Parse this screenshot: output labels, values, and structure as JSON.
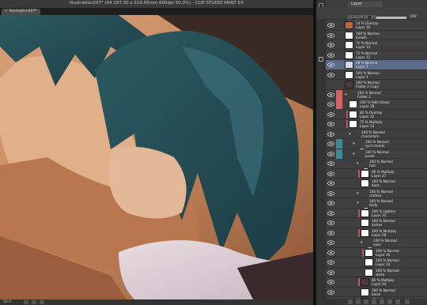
{
  "app_title": "Illustration207* (A4 297.00 x 210.00mm 600dpi 50.0%) - CLIP STUDIO PAINT EX",
  "document_tab": "Illustration207*",
  "canvas": {
    "zoom": "50.0"
  },
  "layer_panel": {
    "tab_label": "Layer",
    "blend_mode": "Normal",
    "opacity_value": "100",
    "layers": [
      {
        "line1": "14 % Overlay",
        "line2": "Layer 16",
        "kind": "layer",
        "thumb": "#b86a3a",
        "indent": 0,
        "visible": true,
        "selected": false,
        "clip": false,
        "chip": ""
      },
      {
        "line1": "100 % Normal",
        "line2": "breath",
        "kind": "layer",
        "thumb": "#ffffff",
        "indent": 0,
        "visible": true,
        "selected": false,
        "clip": false,
        "chip": ""
      },
      {
        "line1": "72 % Normal",
        "line2": "Layer 12",
        "kind": "layer",
        "thumb": "#ffffff",
        "indent": 0,
        "visible": true,
        "selected": false,
        "clip": false,
        "chip": ""
      },
      {
        "line1": "72 % Normal",
        "line2": "Layer 11",
        "kind": "layer",
        "thumb": "#ffffff",
        "indent": 0,
        "visible": true,
        "selected": false,
        "clip": false,
        "chip": ""
      },
      {
        "line1": "48 % Normal",
        "line2": "Layer 7",
        "kind": "layer",
        "thumb": "#d8d8e8",
        "indent": 0,
        "visible": true,
        "selected": true,
        "clip": false,
        "chip": ""
      },
      {
        "line1": "100 % Normal",
        "line2": "Layer 1",
        "kind": "layer",
        "thumb": "#ffffff",
        "indent": 0,
        "visible": true,
        "selected": false,
        "clip": false,
        "chip": ""
      },
      {
        "line1": "100 % Normal",
        "line2": "Folder 2 Copy",
        "kind": "layer",
        "thumb": "#4a3a3a",
        "indent": 0,
        "visible": false,
        "selected": false,
        "clip": false,
        "chip": ""
      },
      {
        "line1": "100 % Normal",
        "line2": "Folder 2",
        "kind": "folder",
        "thumb": "",
        "indent": 0,
        "visible": true,
        "selected": false,
        "clip": false,
        "chip": "#d86060"
      },
      {
        "line1": "100 % Add (Glow)",
        "line2": "Layer 39",
        "kind": "layer",
        "thumb": "#ffffff",
        "indent": 1,
        "visible": true,
        "selected": false,
        "clip": false,
        "chip": "#d86060"
      },
      {
        "line1": "82 % Overlay",
        "line2": "Layer 32",
        "kind": "layer",
        "thumb": "#ffffff",
        "indent": 1,
        "visible": true,
        "selected": false,
        "clip": true,
        "chip": ""
      },
      {
        "line1": "75 % Multiply",
        "line2": "Layer 23",
        "kind": "layer",
        "thumb": "#ffffff",
        "indent": 1,
        "visible": true,
        "selected": false,
        "clip": true,
        "chip": ""
      },
      {
        "line1": "100 % Normal",
        "line2": "characters",
        "kind": "folder",
        "thumb": "",
        "indent": 1,
        "visible": true,
        "selected": false,
        "clip": false,
        "chip": ""
      },
      {
        "line1": "100 % Normal",
        "line2": "ryo's hands",
        "kind": "folder",
        "thumb": "",
        "indent": 2,
        "visible": true,
        "selected": false,
        "clip": false,
        "chip": "#3a8a9a"
      },
      {
        "line1": "100 % Normal",
        "line2": "jonah",
        "kind": "folder",
        "thumb": "",
        "indent": 2,
        "visible": true,
        "selected": false,
        "clip": false,
        "chip": "#3a8a9a"
      },
      {
        "line1": "100 % Normal",
        "line2": "hair",
        "kind": "folder",
        "thumb": "",
        "indent": 3,
        "visible": true,
        "selected": false,
        "clip": false,
        "chip": ""
      },
      {
        "line1": "66 % Multiply",
        "line2": "Layer 27",
        "kind": "layer",
        "thumb": "#ffffff",
        "indent": 4,
        "visible": true,
        "selected": false,
        "clip": true,
        "chip": ""
      },
      {
        "line1": "100 % Normal",
        "line2": "base",
        "kind": "layer",
        "thumb": "#ffffff",
        "indent": 4,
        "visible": true,
        "selected": false,
        "clip": false,
        "chip": ""
      },
      {
        "line1": "100 % Normal",
        "line2": "clothes",
        "kind": "folder",
        "thumb": "",
        "indent": 3,
        "visible": true,
        "selected": false,
        "clip": false,
        "chip": ""
      },
      {
        "line1": "100 % Normal",
        "line2": "body",
        "kind": "folder",
        "thumb": "",
        "indent": 3,
        "visible": true,
        "selected": false,
        "clip": false,
        "chip": ""
      },
      {
        "line1": "100 % Lighten",
        "line2": "Layer 35",
        "kind": "layer",
        "thumb": "#ffffff",
        "indent": 4,
        "visible": true,
        "selected": false,
        "clip": true,
        "chip": ""
      },
      {
        "line1": "100 % Normal",
        "line2": "lashes",
        "kind": "layer",
        "thumb": "#ffffff",
        "indent": 4,
        "visible": true,
        "selected": false,
        "clip": false,
        "chip": ""
      },
      {
        "line1": "100 % Multiply",
        "line2": "Layer 28",
        "kind": "layer",
        "thumb": "#ffffff",
        "indent": 4,
        "visible": true,
        "selected": false,
        "clip": true,
        "chip": ""
      },
      {
        "line1": "100 % Normal",
        "line2": "eyes",
        "kind": "folder",
        "thumb": "",
        "indent": 4,
        "visible": true,
        "selected": false,
        "clip": false,
        "chip": ""
      },
      {
        "line1": "100 % Normal",
        "line2": "Layer 34",
        "kind": "layer",
        "thumb": "#ffffff",
        "indent": 5,
        "visible": true,
        "selected": false,
        "clip": true,
        "chip": ""
      },
      {
        "line1": "100 % Normal",
        "line2": "Layer 33",
        "kind": "layer",
        "thumb": "#ffffff",
        "indent": 5,
        "visible": true,
        "selected": false,
        "clip": false,
        "chip": ""
      },
      {
        "line1": "100 % Normal",
        "line2": "white",
        "kind": "layer",
        "thumb": "#ffffff",
        "indent": 5,
        "visible": true,
        "selected": false,
        "clip": false,
        "chip": ""
      },
      {
        "line1": "86 % Multiply",
        "line2": "Layer 24",
        "kind": "layer",
        "thumb": "#4a3a3a",
        "indent": 4,
        "visible": true,
        "selected": false,
        "clip": true,
        "chip": ""
      },
      {
        "line1": "100 % Normal",
        "line2": "blush",
        "kind": "layer",
        "thumb": "#ffffff",
        "indent": 4,
        "visible": true,
        "selected": false,
        "clip": false,
        "chip": ""
      },
      {
        "line1": "67 % Normal",
        "line2": "",
        "kind": "layer",
        "thumb": "#ffffff",
        "indent": 4,
        "visible": true,
        "selected": false,
        "clip": true,
        "chip": ""
      }
    ]
  },
  "icons": {
    "eye": "eye-icon",
    "folder": "folder-icon",
    "clip": "clipping-indicator",
    "pen": "pen-icon"
  },
  "colors": {
    "selected": "#5a6a8a",
    "chip_red": "#d86060",
    "chip_teal": "#3a8a9a"
  }
}
